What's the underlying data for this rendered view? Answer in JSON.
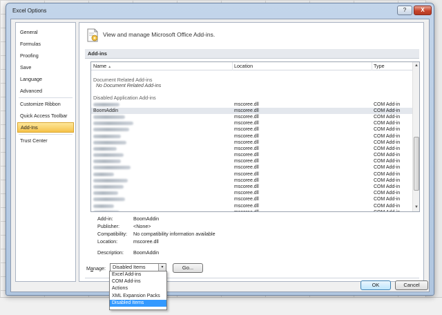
{
  "window": {
    "title": "Excel Options",
    "help_glyph": "?",
    "close_glyph": "X"
  },
  "nav": {
    "items": [
      {
        "label": "General"
      },
      {
        "label": "Formulas"
      },
      {
        "label": "Proofing"
      },
      {
        "label": "Save"
      },
      {
        "label": "Language"
      },
      {
        "label": "Advanced"
      },
      {
        "label": "Customize Ribbon"
      },
      {
        "label": "Quick Access Toolbar"
      },
      {
        "label": "Add-Ins",
        "selected": true
      },
      {
        "label": "Trust Center"
      }
    ]
  },
  "header": {
    "text": "View and manage Microsoft Office Add-ins."
  },
  "section": {
    "title": "Add-ins"
  },
  "table": {
    "columns": [
      "Name",
      "Location",
      "Type"
    ],
    "sort_glyph": "▲",
    "groups": {
      "document": {
        "label": "Document Related Add-ins",
        "empty": "No Document Related Add-ins"
      },
      "disabled": {
        "label": "Disabled Application Add-ins"
      }
    },
    "rows": [
      {
        "name": "",
        "location": "mscoree.dll",
        "type": "COM Add-in"
      },
      {
        "name": "BoomAddin",
        "location": "mscoree.dll",
        "type": "COM Add-in",
        "selected": true
      },
      {
        "name": "",
        "location": "mscoree.dll",
        "type": "COM Add-in"
      },
      {
        "name": "",
        "location": "mscoree.dll",
        "type": "COM Add-in"
      },
      {
        "name": "",
        "location": "mscoree.dll",
        "type": "COM Add-in"
      },
      {
        "name": "",
        "location": "mscoree.dll",
        "type": "COM Add-in"
      },
      {
        "name": "",
        "location": "mscoree.dll",
        "type": "COM Add-in"
      },
      {
        "name": "",
        "location": "mscoree.dll",
        "type": "COM Add-in"
      },
      {
        "name": "",
        "location": "mscoree.dll",
        "type": "COM Add-in"
      },
      {
        "name": "",
        "location": "mscoree.dll",
        "type": "COM Add-in"
      },
      {
        "name": "",
        "location": "mscoree.dll",
        "type": "COM Add-in"
      },
      {
        "name": "",
        "location": "mscoree.dll",
        "type": "COM Add-in"
      },
      {
        "name": "",
        "location": "mscoree.dll",
        "type": "COM Add-in"
      },
      {
        "name": "",
        "location": "mscoree.dll",
        "type": "COM Add-in"
      },
      {
        "name": "",
        "location": "mscoree.dll",
        "type": "COM Add-in"
      },
      {
        "name": "",
        "location": "mscoree.dll",
        "type": "COM Add-in"
      },
      {
        "name": "",
        "location": "mscoree.dll",
        "type": "COM Add-in"
      },
      {
        "name": "",
        "location": "mscoree.dll",
        "type": "COM Add-in"
      }
    ],
    "scroll_up_glyph": "▲",
    "scroll_down_glyph": "▼"
  },
  "details": {
    "addin_label": "Add-in:",
    "addin_value": "BoomAddin",
    "publisher_label": "Publisher:",
    "publisher_value": "<None>",
    "compat_label": "Compatibility:",
    "compat_value": "No compatibility information available",
    "location_label": "Location:",
    "location_value": "mscoree.dll",
    "description_label": "Description:",
    "description_value": "BoomAddin"
  },
  "manage": {
    "label_prefix": "M",
    "label_underlined": "a",
    "label_suffix": "nage:",
    "selected": "Disabled Items",
    "dropdown_glyph": "▾",
    "options": [
      "Excel Add-ins",
      "COM Add-ins",
      "Actions",
      "XML Expansion Packs",
      "Disabled Items"
    ],
    "highlighted_option": "Disabled Items",
    "go_label": "Go..."
  },
  "footer": {
    "ok_label": "OK",
    "cancel_label": "Cancel"
  }
}
